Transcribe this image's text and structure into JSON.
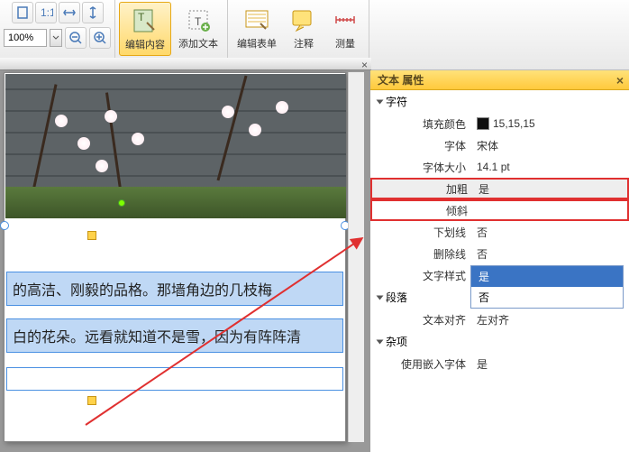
{
  "toolbar": {
    "zoom": "100%",
    "edit_content": "编辑内容",
    "add_text": "添加文本",
    "edit_form": "编辑表单",
    "annotate": "注释",
    "measure": "测量"
  },
  "document": {
    "text1": "的高洁、刚毅的品格。那墙角边的几枝梅",
    "text2": "白的花朵。远看就知道不是雪，因为有阵阵清"
  },
  "panel": {
    "title": "文本 属性",
    "sections": {
      "char": "字符",
      "para": "段落",
      "misc": "杂项"
    },
    "rows": {
      "fill_color": {
        "label": "填充颜色",
        "value": "15,15,15"
      },
      "font": {
        "label": "字体",
        "value": "宋体"
      },
      "font_size": {
        "label": "字体大小",
        "value": "14.1 pt"
      },
      "bold": {
        "label": "加粗",
        "value": "是"
      },
      "italic": {
        "label": "倾斜",
        "value": ""
      },
      "underline": {
        "label": "下划线",
        "value": "否"
      },
      "strike": {
        "label": "删除线",
        "value": "否"
      },
      "style": {
        "label": "文字样式",
        "value": "否"
      },
      "align": {
        "label": "文本对齐",
        "value": "左对齐"
      },
      "embed": {
        "label": "使用嵌入字体",
        "value": "是"
      }
    },
    "dropdown": {
      "opt_yes": "是",
      "opt_no": "否"
    }
  }
}
